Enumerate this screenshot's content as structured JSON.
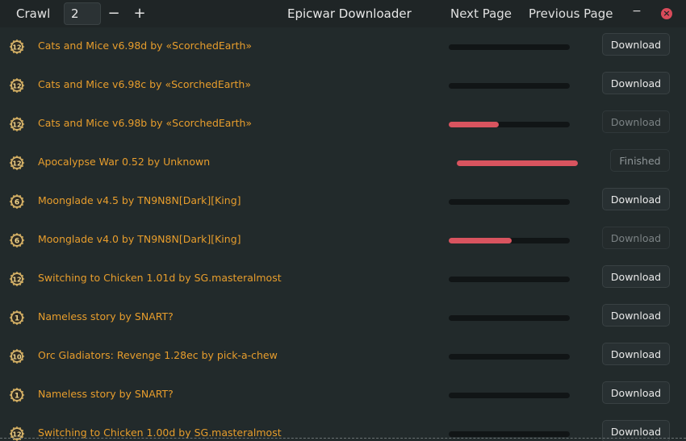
{
  "header": {
    "crawl_label": "Crawl",
    "crawl_value": "2",
    "decrement": "−",
    "increment": "+",
    "title": "Epicwar Downloader",
    "next_page": "Next Page",
    "previous_page": "Previous Page",
    "minimize": "−",
    "close": "×"
  },
  "icons": {
    "map_icon": "map-badge-icon"
  },
  "colors": {
    "name": "#e79d2c",
    "progress": "#d9545f",
    "close": "#d94b5a"
  },
  "rows": [
    {
      "badge": "12",
      "name": "Cats and Mice v6.98d by «ScorchedEarth»",
      "progress": 0,
      "button": "Download",
      "state": "idle"
    },
    {
      "badge": "12",
      "name": "Cats and Mice v6.98c by «ScorchedEarth»",
      "progress": 0,
      "button": "Download",
      "state": "idle"
    },
    {
      "badge": "12",
      "name": "Cats and Mice v6.98b by «ScorchedEarth»",
      "progress": 0.41,
      "button": "Download",
      "state": "disabled"
    },
    {
      "badge": "12",
      "name": "Apocalypse War 0.52 by Unknown",
      "progress": 1.0,
      "button": "Finished",
      "state": "finished"
    },
    {
      "badge": "6",
      "name": "Moonglade v4.5 by TN9N8N[Dark][King]",
      "progress": 0,
      "button": "Download",
      "state": "idle"
    },
    {
      "badge": "6",
      "name": "Moonglade v4.0 by TN9N8N[Dark][King]",
      "progress": 0.52,
      "button": "Download",
      "state": "disabled"
    },
    {
      "badge": "12",
      "name": "Switching to Chicken 1.01d by SG.masteralmost",
      "progress": 0,
      "button": "Download",
      "state": "idle"
    },
    {
      "badge": "1",
      "name": "Nameless story by SNART?",
      "progress": 0,
      "button": "Download",
      "state": "idle"
    },
    {
      "badge": "10",
      "name": "Orc Gladiators: Revenge 1.28ec by pick-a-chew",
      "progress": 0,
      "button": "Download",
      "state": "idle"
    },
    {
      "badge": "1",
      "name": "Nameless story by SNART?",
      "progress": 0,
      "button": "Download",
      "state": "idle"
    },
    {
      "badge": "12",
      "name": "Switching to Chicken 1.00d by SG.masteralmost",
      "progress": 0,
      "button": "Download",
      "state": "idle"
    }
  ]
}
